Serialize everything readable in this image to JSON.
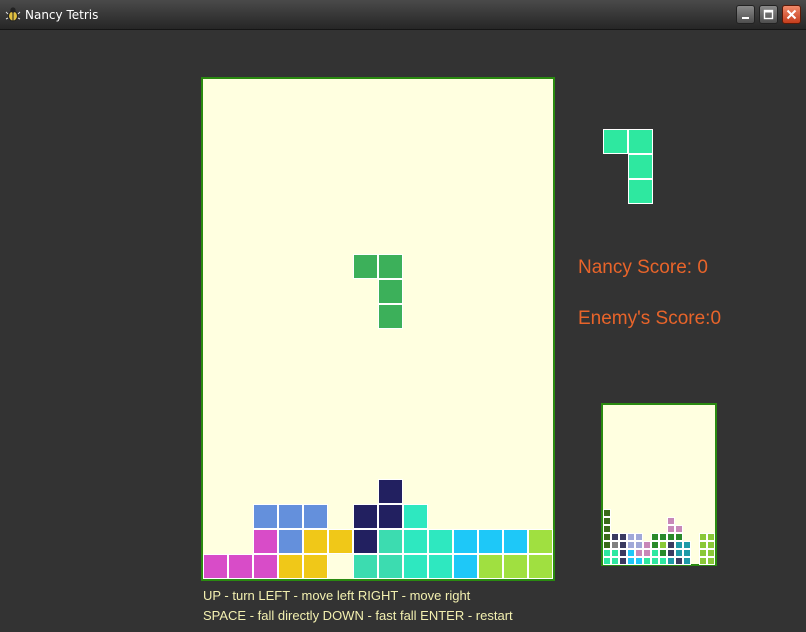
{
  "window": {
    "title": "Nancy Tetris",
    "icon": "bug-icon",
    "controls": [
      "minimize-icon",
      "maximize-icon",
      "close-icon"
    ]
  },
  "colors": {
    "background": "#333333",
    "board_bg": "#ffffe0",
    "board_border": "#2a8a10",
    "score_text": "#e8642a",
    "help_text": "#f3f0b0"
  },
  "scores": {
    "nancy": "Nancy Score: 0",
    "enemy": "Enemy's Score:0"
  },
  "help": {
    "line1": "UP - turn  LEFT - move left  RIGHT - move right",
    "line2": "SPACE - fall directly  DOWN - fast fall  ENTER - restart"
  },
  "board": {
    "cols": 14,
    "rows": 20,
    "falling_piece": {
      "color": "#3cb05a",
      "cells": [
        [
          6,
          7
        ],
        [
          7,
          7
        ],
        [
          7,
          8
        ],
        [
          7,
          9
        ]
      ]
    },
    "cells": [
      [
        7,
        16,
        "#222060"
      ],
      [
        2,
        17,
        "#6490dc"
      ],
      [
        3,
        17,
        "#6490dc"
      ],
      [
        4,
        17,
        "#6490dc"
      ],
      [
        6,
        17,
        "#222060"
      ],
      [
        7,
        17,
        "#222060"
      ],
      [
        8,
        17,
        "#2ee8c0"
      ],
      [
        2,
        18,
        "#d84cc8"
      ],
      [
        3,
        18,
        "#6490dc"
      ],
      [
        4,
        18,
        "#f0c818"
      ],
      [
        5,
        18,
        "#f0c818"
      ],
      [
        6,
        18,
        "#222060"
      ],
      [
        7,
        18,
        "#3cdcb0"
      ],
      [
        8,
        18,
        "#2ee8c0"
      ],
      [
        9,
        18,
        "#2ee8c0"
      ],
      [
        10,
        18,
        "#1ec8f8"
      ],
      [
        11,
        18,
        "#1ec8f8"
      ],
      [
        12,
        18,
        "#1ec8f8"
      ],
      [
        13,
        18,
        "#a0e040"
      ],
      [
        0,
        19,
        "#d84cc8"
      ],
      [
        1,
        19,
        "#d84cc8"
      ],
      [
        2,
        19,
        "#d84cc8"
      ],
      [
        3,
        19,
        "#f0c818"
      ],
      [
        4,
        19,
        "#f0c818"
      ],
      [
        6,
        19,
        "#3cdcb0"
      ],
      [
        7,
        19,
        "#3cdcb0"
      ],
      [
        8,
        19,
        "#2ee8c0"
      ],
      [
        9,
        19,
        "#2ee8c0"
      ],
      [
        10,
        19,
        "#1ec8f8"
      ],
      [
        11,
        19,
        "#a0e040"
      ],
      [
        12,
        19,
        "#a0e040"
      ],
      [
        13,
        19,
        "#a0e040"
      ]
    ]
  },
  "next_piece": {
    "color": "#2ee8a0",
    "cells": [
      [
        0,
        0
      ],
      [
        1,
        0
      ],
      [
        1,
        1
      ],
      [
        1,
        2
      ]
    ]
  },
  "enemy_board": {
    "cols": 14,
    "rows": 20,
    "cells": [
      [
        0,
        13,
        "#3a6a1a"
      ],
      [
        0,
        14,
        "#3a6a1a"
      ],
      [
        8,
        14,
        "#c888b8"
      ],
      [
        0,
        15,
        "#3a6a1a"
      ],
      [
        8,
        15,
        "#c888b8"
      ],
      [
        9,
        15,
        "#c888b8"
      ],
      [
        0,
        16,
        "#3a6a1a"
      ],
      [
        1,
        16,
        "#3a3a60"
      ],
      [
        2,
        16,
        "#3a3a60"
      ],
      [
        3,
        16,
        "#a0a8d8"
      ],
      [
        4,
        16,
        "#a0a8d8"
      ],
      [
        6,
        16,
        "#2a8a2a"
      ],
      [
        7,
        16,
        "#2a8a2a"
      ],
      [
        8,
        16,
        "#2a8a2a"
      ],
      [
        9,
        16,
        "#2a8a2a"
      ],
      [
        12,
        16,
        "#8ac838"
      ],
      [
        13,
        16,
        "#8ac838"
      ],
      [
        0,
        17,
        "#3a6a1a"
      ],
      [
        1,
        17,
        "#808080"
      ],
      [
        2,
        17,
        "#3a3a60"
      ],
      [
        3,
        17,
        "#a0a8d8"
      ],
      [
        4,
        17,
        "#a0a8d8"
      ],
      [
        5,
        17,
        "#c888b8"
      ],
      [
        6,
        17,
        "#2a8a2a"
      ],
      [
        7,
        17,
        "#8ac838"
      ],
      [
        8,
        17,
        "#3a3a60"
      ],
      [
        9,
        17,
        "#1e9aa8"
      ],
      [
        10,
        17,
        "#1e9aa8"
      ],
      [
        12,
        17,
        "#8ac838"
      ],
      [
        13,
        17,
        "#8ac838"
      ],
      [
        0,
        18,
        "#2ee8a0"
      ],
      [
        1,
        18,
        "#2ee8a0"
      ],
      [
        2,
        18,
        "#3a3a60"
      ],
      [
        3,
        18,
        "#1ec8f8"
      ],
      [
        4,
        18,
        "#c888b8"
      ],
      [
        5,
        18,
        "#c888b8"
      ],
      [
        6,
        18,
        "#2ee8a0"
      ],
      [
        7,
        18,
        "#2a8a2a"
      ],
      [
        8,
        18,
        "#3a3a60"
      ],
      [
        9,
        18,
        "#1e9aa8"
      ],
      [
        10,
        18,
        "#1e9aa8"
      ],
      [
        12,
        18,
        "#8ac838"
      ],
      [
        13,
        18,
        "#8ac838"
      ],
      [
        0,
        19,
        "#2ee8a0"
      ],
      [
        1,
        19,
        "#2ee8a0"
      ],
      [
        2,
        19,
        "#3a3a60"
      ],
      [
        3,
        19,
        "#1ec8f8"
      ],
      [
        4,
        19,
        "#1ec8f8"
      ],
      [
        5,
        19,
        "#2ee8a0"
      ],
      [
        6,
        19,
        "#2ee8a0"
      ],
      [
        7,
        19,
        "#2ee8a0"
      ],
      [
        8,
        19,
        "#1e9aa8"
      ],
      [
        9,
        19,
        "#3a3a60"
      ],
      [
        10,
        19,
        "#1e9aa8"
      ],
      [
        12,
        19,
        "#8ac838"
      ],
      [
        13,
        19,
        "#8ac838"
      ]
    ]
  }
}
